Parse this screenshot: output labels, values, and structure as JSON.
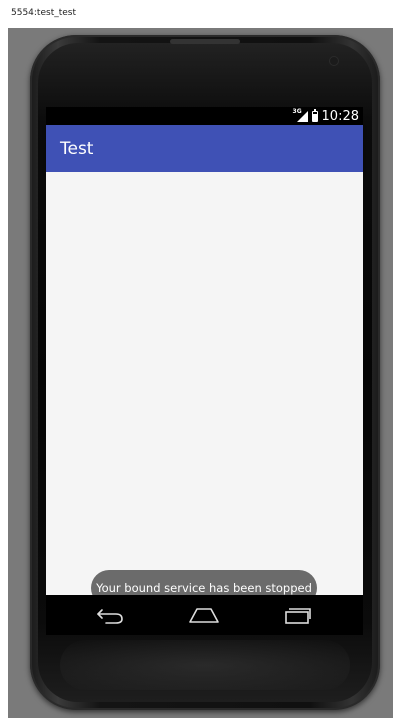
{
  "window": {
    "title": "5554:test_test"
  },
  "status_bar": {
    "network_label": "3G",
    "time": "10:28",
    "icons": [
      "signal-icon",
      "battery-icon"
    ]
  },
  "app_bar": {
    "title": "Test",
    "color": "#3f51b5"
  },
  "toast": {
    "message": "Your bound service has been stopped"
  },
  "nav_bar": {
    "buttons": [
      "back",
      "home",
      "recents"
    ]
  },
  "colors": {
    "content_bg": "#f5f5f5",
    "toast_bg": "#6b6b6b",
    "emulator_bg": "#7a7a7a"
  }
}
